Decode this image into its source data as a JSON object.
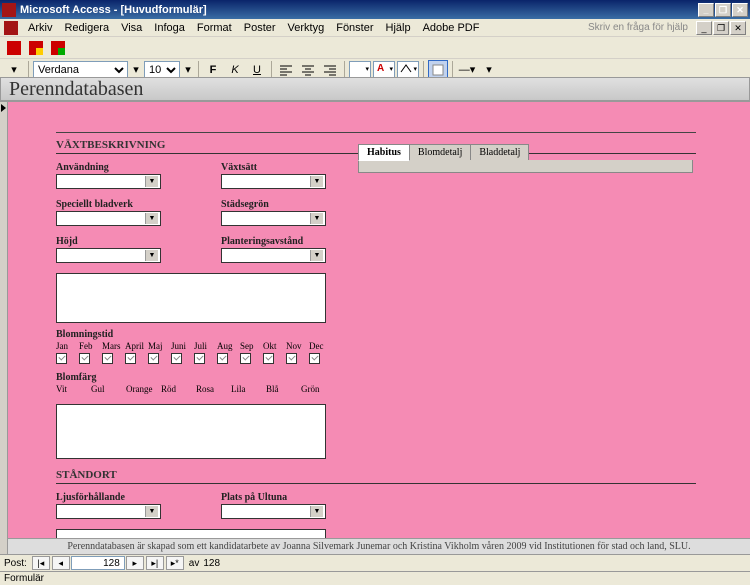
{
  "titlebar": {
    "app": "Microsoft Access",
    "doc": "[Huvudformulär]"
  },
  "menu": {
    "arkiv": "Arkiv",
    "redigera": "Redigera",
    "visa": "Visa",
    "infoga": "Infoga",
    "format": "Format",
    "poster": "Poster",
    "verktyg": "Verktyg",
    "fonster": "Fönster",
    "hjalp": "Hjälp",
    "adobe": "Adobe PDF",
    "placeholder": "Skriv en fråga för hjälp"
  },
  "toolbar": {
    "font": "Verdana",
    "size": "10"
  },
  "form": {
    "title": "Perenndatabasen",
    "sec1": "VÄXTBESKRIVNING",
    "anvandning": "Användning",
    "vaxtsatt": "Växtsätt",
    "bladverk": "Speciellt bladverk",
    "stadse": "Städsegrön",
    "hojd": "Höjd",
    "plantavst": "Planteringsavstånd",
    "blomningstid": "Blomningstid",
    "months": [
      "Jan",
      "Feb",
      "Mars",
      "April",
      "Maj",
      "Juni",
      "Juli",
      "Aug",
      "Sep",
      "Okt",
      "Nov",
      "Dec"
    ],
    "blomfarg": "Blomfärg",
    "colors": [
      "Vit",
      "Gul",
      "Orange",
      "Röd",
      "Rosa",
      "Lila",
      "Blå",
      "Grön"
    ],
    "sec2": "STÅNDORT",
    "ljus": "Ljusförhållande",
    "plats": "Plats på Ultuna",
    "tabs": [
      "Habitus",
      "Blomdetalj",
      "Bladdetalj"
    ],
    "footer": "Perenndatabasen är skapad som ett kandidatarbete av Joanna Silvemark Junemar och Kristina Vikholm våren 2009 vid Institutionen för stad och land, SLU."
  },
  "nav": {
    "label": "Post:",
    "current": "128",
    "of_label": "av",
    "total": "128"
  },
  "status": "Formulär"
}
